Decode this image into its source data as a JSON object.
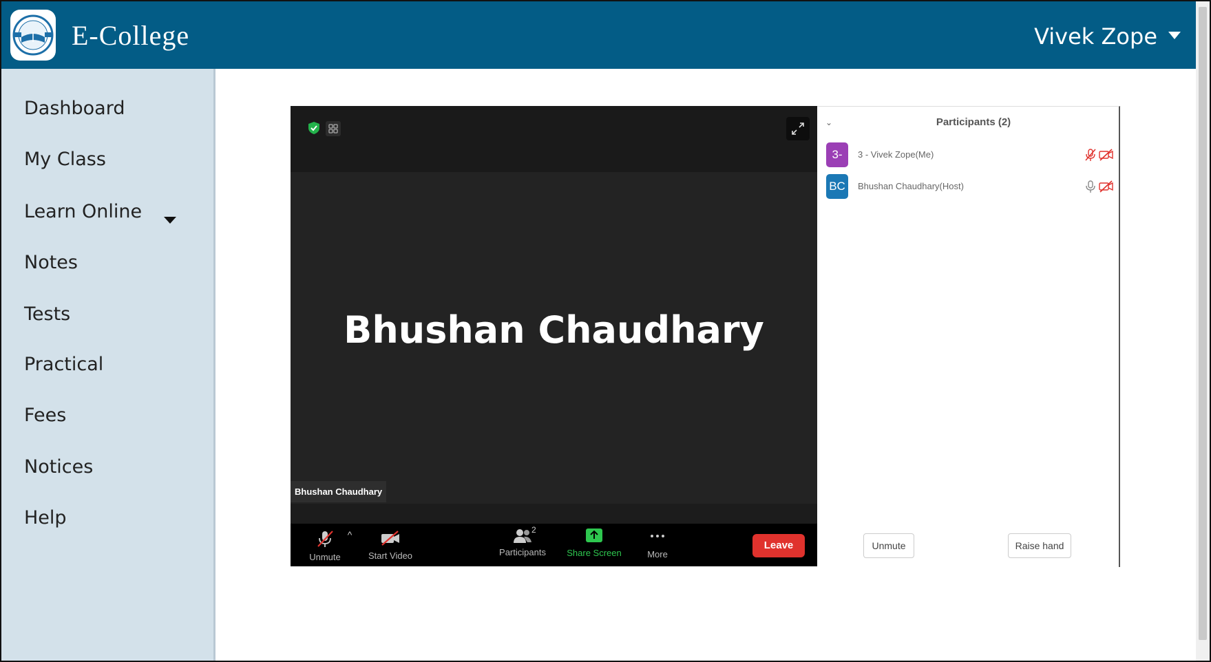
{
  "header": {
    "brand": "E-College",
    "user_name": "Vivek Zope",
    "brand_color": "#035c86"
  },
  "sidebar": {
    "background": "#d3e1ea",
    "items": [
      {
        "label": "Dashboard"
      },
      {
        "label": "My Class"
      },
      {
        "label": "Learn Online",
        "has_dropdown": true
      },
      {
        "label": "Notes"
      },
      {
        "label": "Tests"
      },
      {
        "label": "Practical"
      },
      {
        "label": "Fees"
      },
      {
        "label": "Notices"
      },
      {
        "label": "Help"
      }
    ]
  },
  "meeting": {
    "active_speaker": "Bhushan Chaudhary",
    "name_tag": "Bhushan Chaudhary",
    "toolbar": {
      "unmute": "Unmute",
      "start_video": "Start Video",
      "participants": "Participants",
      "participants_count": "2",
      "share_screen": "Share Screen",
      "more": "More",
      "leave": "Leave"
    },
    "icons": [
      "shield-check-icon",
      "grid-view-icon",
      "expand-icon",
      "muted-mic-icon",
      "video-off-icon",
      "participants-icon",
      "share-screen-icon",
      "more-icon"
    ]
  },
  "participants_panel": {
    "title": "Participants (2)",
    "participants": [
      {
        "initials": "3-",
        "name": "3 - Vivek Zope(Me)",
        "avatar_color": "#9b3fb5",
        "mic": "muted",
        "video": "off"
      },
      {
        "initials": "BC",
        "name": "Bhushan Chaudhary(Host)",
        "avatar_color": "#1b78b5",
        "mic": "on",
        "video": "off"
      }
    ],
    "unmute_button": "Unmute",
    "raise_hand_button": "Raise hand"
  }
}
